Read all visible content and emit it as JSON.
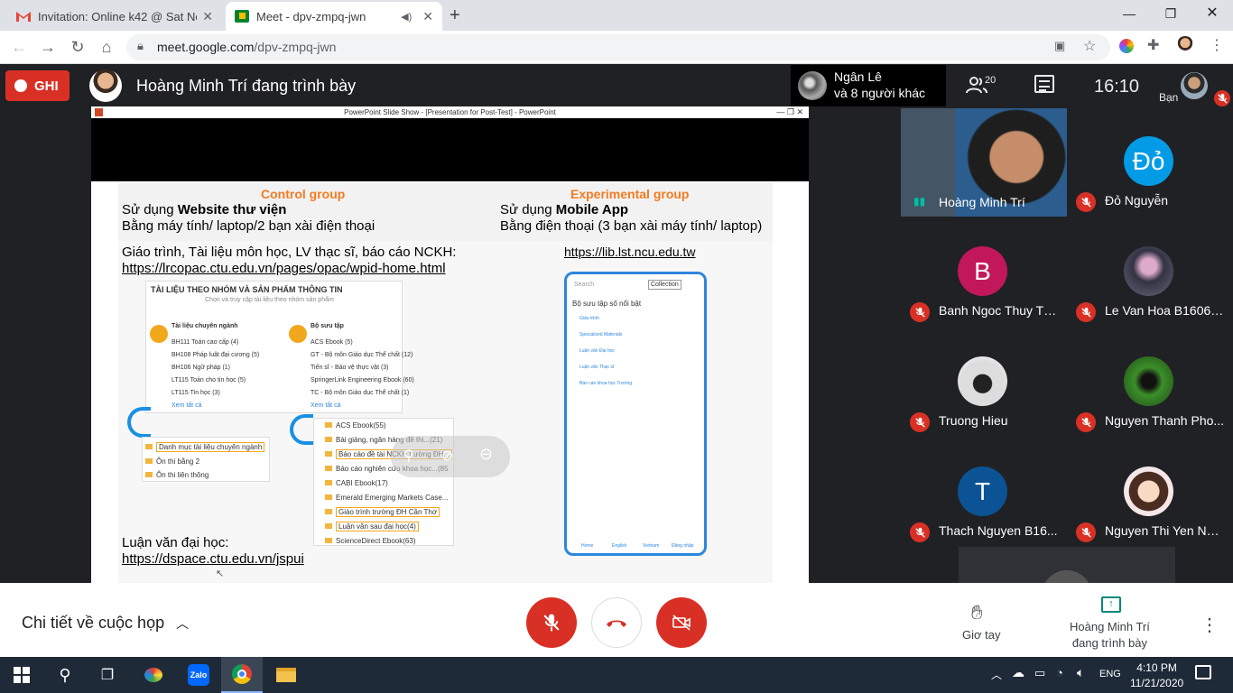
{
  "browser": {
    "tabs": [
      {
        "title": "Invitation: Online k42 @ Sat Nov",
        "active": false
      },
      {
        "title": "Meet - dpv-zmpq-jwn",
        "active": true
      }
    ],
    "url_host": "meet.google.com",
    "url_path": "/dpv-zmpq-jwn"
  },
  "meet": {
    "record_label": "GHI",
    "presenting_title": "Hoàng Minh Trí đang trình bày",
    "pinned_name": "Ngân Lê",
    "pinned_others": "và 8 người khác",
    "people_count": "20",
    "clock": "16:10",
    "self_label": "Bạn"
  },
  "slide": {
    "window_title": "PowerPoint Slide Show - [Presentation for Post-Test] - PowerPoint",
    "control_head": "Control group",
    "control_line1_prefix": "Sử dụng ",
    "control_line1_bold": "Website thư viện",
    "control_line2": "Bằng máy tính/ laptop/2 bạn xài điện thoại",
    "exp_head": "Experimental group",
    "exp_line1_prefix": "Sử dụng ",
    "exp_line1_bold": "Mobile App",
    "exp_line2": "Bằng điện thoại (3 bạn xài máy tính/ laptop)",
    "resources": "Giáo trình, Tài liệu môn học, LV thạc sĩ, báo cáo NCKH:",
    "opac_link": "https://lrcopac.ctu.edu.vn/pages/opac/wpid-home.html",
    "lib_link": "https://lib.lst.ncu.edu.tw",
    "thesis_label": "Luận văn đại học:",
    "dspace_link": "https://dspace.ctu.edu.vn/jspui",
    "opac_title": "TÀI LIỆU THEO NHÓM VÀ SẢN PHẨM THÔNG TIN",
    "opac_sub": "Chọn và truy cập tài liệu theo nhóm sản phẩm",
    "col1_head": "Tài liệu chuyên ngành",
    "col1_items": [
      "BH111 Toán cao cấp (4)",
      "BH108 Pháp luật đại cương (5)",
      "BH106 Ngữ pháp (1)",
      "LT115 Toán cho tin học (5)",
      "LT115 Tin học (3)"
    ],
    "col1_more": "Xem tất cả",
    "col2_head": "Bộ sưu tập",
    "col2_items": [
      "ACS Ebook (5)",
      "GT - Bộ môn Giáo dục Thể chất (12)",
      "Tiến sĩ - Bảo vệ thực vật (3)",
      "SpringerLink Engineering Ebook (60)",
      "TC - Bộ môn Giáo dục Thể chất (1)"
    ],
    "col2_more": "Xem tất cả",
    "tree1": [
      "Danh mục tài liệu chuyên ngành",
      "Ôn thi bằng 2",
      "Ôn thi liên thông"
    ],
    "tree2": [
      "ACS Ebook(55)",
      "Bài giảng, ngân hàng đề thi...(21)",
      "Báo cáo đề tài NCKH trường ĐH...",
      "Báo cáo nghiên cứu khoa học...(85",
      "CABI Ebook(17)",
      "Emerald Emerging Markets Case...",
      "Giáo trình trường ĐH Cần Thơ",
      "Luận văn sau đại học(4)",
      "ScienceDirect Ebook(63)"
    ],
    "phone": {
      "search": "Search",
      "select": "Collection",
      "heading": "Bộ sưu tập số nổi bật",
      "items": [
        "Giáo trình",
        "Specialized Materials",
        "Luận văn Đại học",
        "Luận văn Thạc sĩ",
        "Báo cáo khoa học Trường"
      ],
      "nav": [
        "Home",
        "English",
        "Vietnam",
        "Đăng nhập"
      ]
    }
  },
  "participants": [
    {
      "name": "Hoàng Minh Trí",
      "initial": "",
      "color": "",
      "video": true,
      "muted": false
    },
    {
      "name": "Đỏ Nguyễn",
      "initial": "Đỏ",
      "color": "#039be5",
      "muted": true
    },
    {
      "name": "Banh Ngoc Thuy Th...",
      "initial": "B",
      "color": "#c2185b",
      "muted": true
    },
    {
      "name": "Le Van Hoa B16067...",
      "initial": "",
      "color": "#556",
      "muted": true
    },
    {
      "name": "Truong Hieu",
      "initial": "",
      "color": "#eee",
      "muted": true
    },
    {
      "name": "Nguyen Thanh Pho...",
      "initial": "",
      "color": "#2f7d1f",
      "muted": true
    },
    {
      "name": "Thach Nguyen B16...",
      "initial": "T",
      "color": "#0b5394",
      "muted": true
    },
    {
      "name": "Nguyen Thi Yen Nhi...",
      "initial": "",
      "color": "#f5e6e8",
      "muted": true
    }
  ],
  "bottom": {
    "details": "Chi tiết về cuộc họp",
    "raise_hand": "Giơ tay",
    "present_line1": "Hoàng Minh Trí",
    "present_line2": "đang trình bày"
  },
  "taskbar": {
    "lang": "ENG",
    "time": "4:10 PM",
    "date": "11/21/2020",
    "zalo": "Zalo"
  }
}
